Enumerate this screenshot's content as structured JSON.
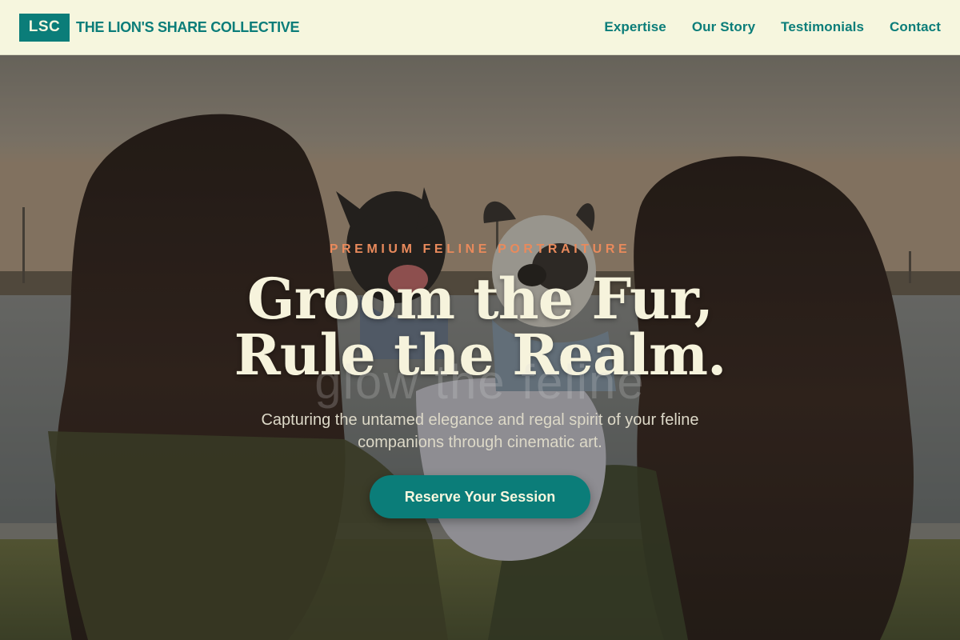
{
  "header": {
    "logo_text": "LSC",
    "brand_name": "THE LION'S SHARE COLLECTIVE",
    "nav": [
      {
        "label": "Expertise"
      },
      {
        "label": "Our Story"
      },
      {
        "label": "Testimonials"
      },
      {
        "label": "Contact"
      }
    ]
  },
  "hero": {
    "eyebrow": "PREMIUM FELINE PORTRAITURE",
    "headline_line1": "Groom the Fur,",
    "headline_line2": "Rule the Realm.",
    "ghost_text": "glow the feline",
    "subtitle": "Capturing the untamed elegance and regal spirit of your feline companions through cinematic art.",
    "cta_label": "Reserve Your Session",
    "image_subject": "two-women-holding-french-bulldogs-by-lake"
  },
  "colors": {
    "accent": "#0b7d79",
    "header_bg": "#f6f6de",
    "eyebrow": "#e98a5c",
    "headline": "#f6f3dc"
  }
}
